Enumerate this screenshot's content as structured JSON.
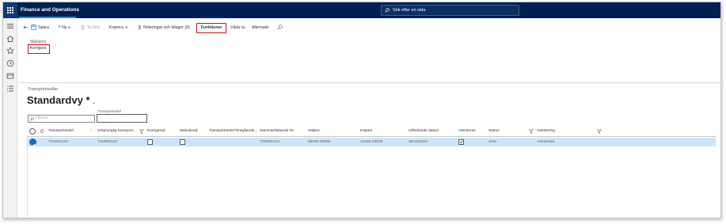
{
  "app": {
    "title": "Finance and Operations"
  },
  "search": {
    "placeholder": "Sök efter en sida"
  },
  "leftnav": {
    "icons": [
      "hamburger-icon",
      "home-icon",
      "star-icon",
      "recent-icon",
      "workspace-icon",
      "list-icon"
    ]
  },
  "toolbar": {
    "save": "Spara",
    "new": "Ny",
    "delete": "Ta bort",
    "copy": "Kopiera",
    "notes": "Noteringar och bilagor (0)",
    "functions": "Funktioner",
    "views": "Våda vy",
    "options": "Alternativ"
  },
  "actions": {
    "group_label": "Makulera",
    "correct": "Korrigera"
  },
  "page": {
    "caption": "Transportsedlar",
    "view_title": "Standardvy",
    "view_modified": "*"
  },
  "filters": {
    "transport_label": "Transportsedel",
    "transport_value": "",
    "quick_filter_placeholder": "Filtrera"
  },
  "grid": {
    "columns": [
      "Transportsedel",
      "Ursprunglig transport...",
      "Korrigerad",
      "Makulerad",
      "Transportsedel föregående...",
      "Sammanfattande ID",
      "Säljare",
      "Köpare",
      "Utfärdande datum",
      "Attesteras",
      "Status",
      "Attestering"
    ],
    "rows": [
      {
        "transport_document": "TS0000123",
        "original_transport": "TS0000123",
        "corrected": false,
        "cancelled": false,
        "previous_transport": "",
        "summary_id": "TS0000123",
        "seller": "00000-00000",
        "buyer": "12345-00000",
        "issue_date": "05/16/2024",
        "to_be_attested": true,
        "status": "Aktiv",
        "attestation": "Attesterad"
      }
    ]
  }
}
